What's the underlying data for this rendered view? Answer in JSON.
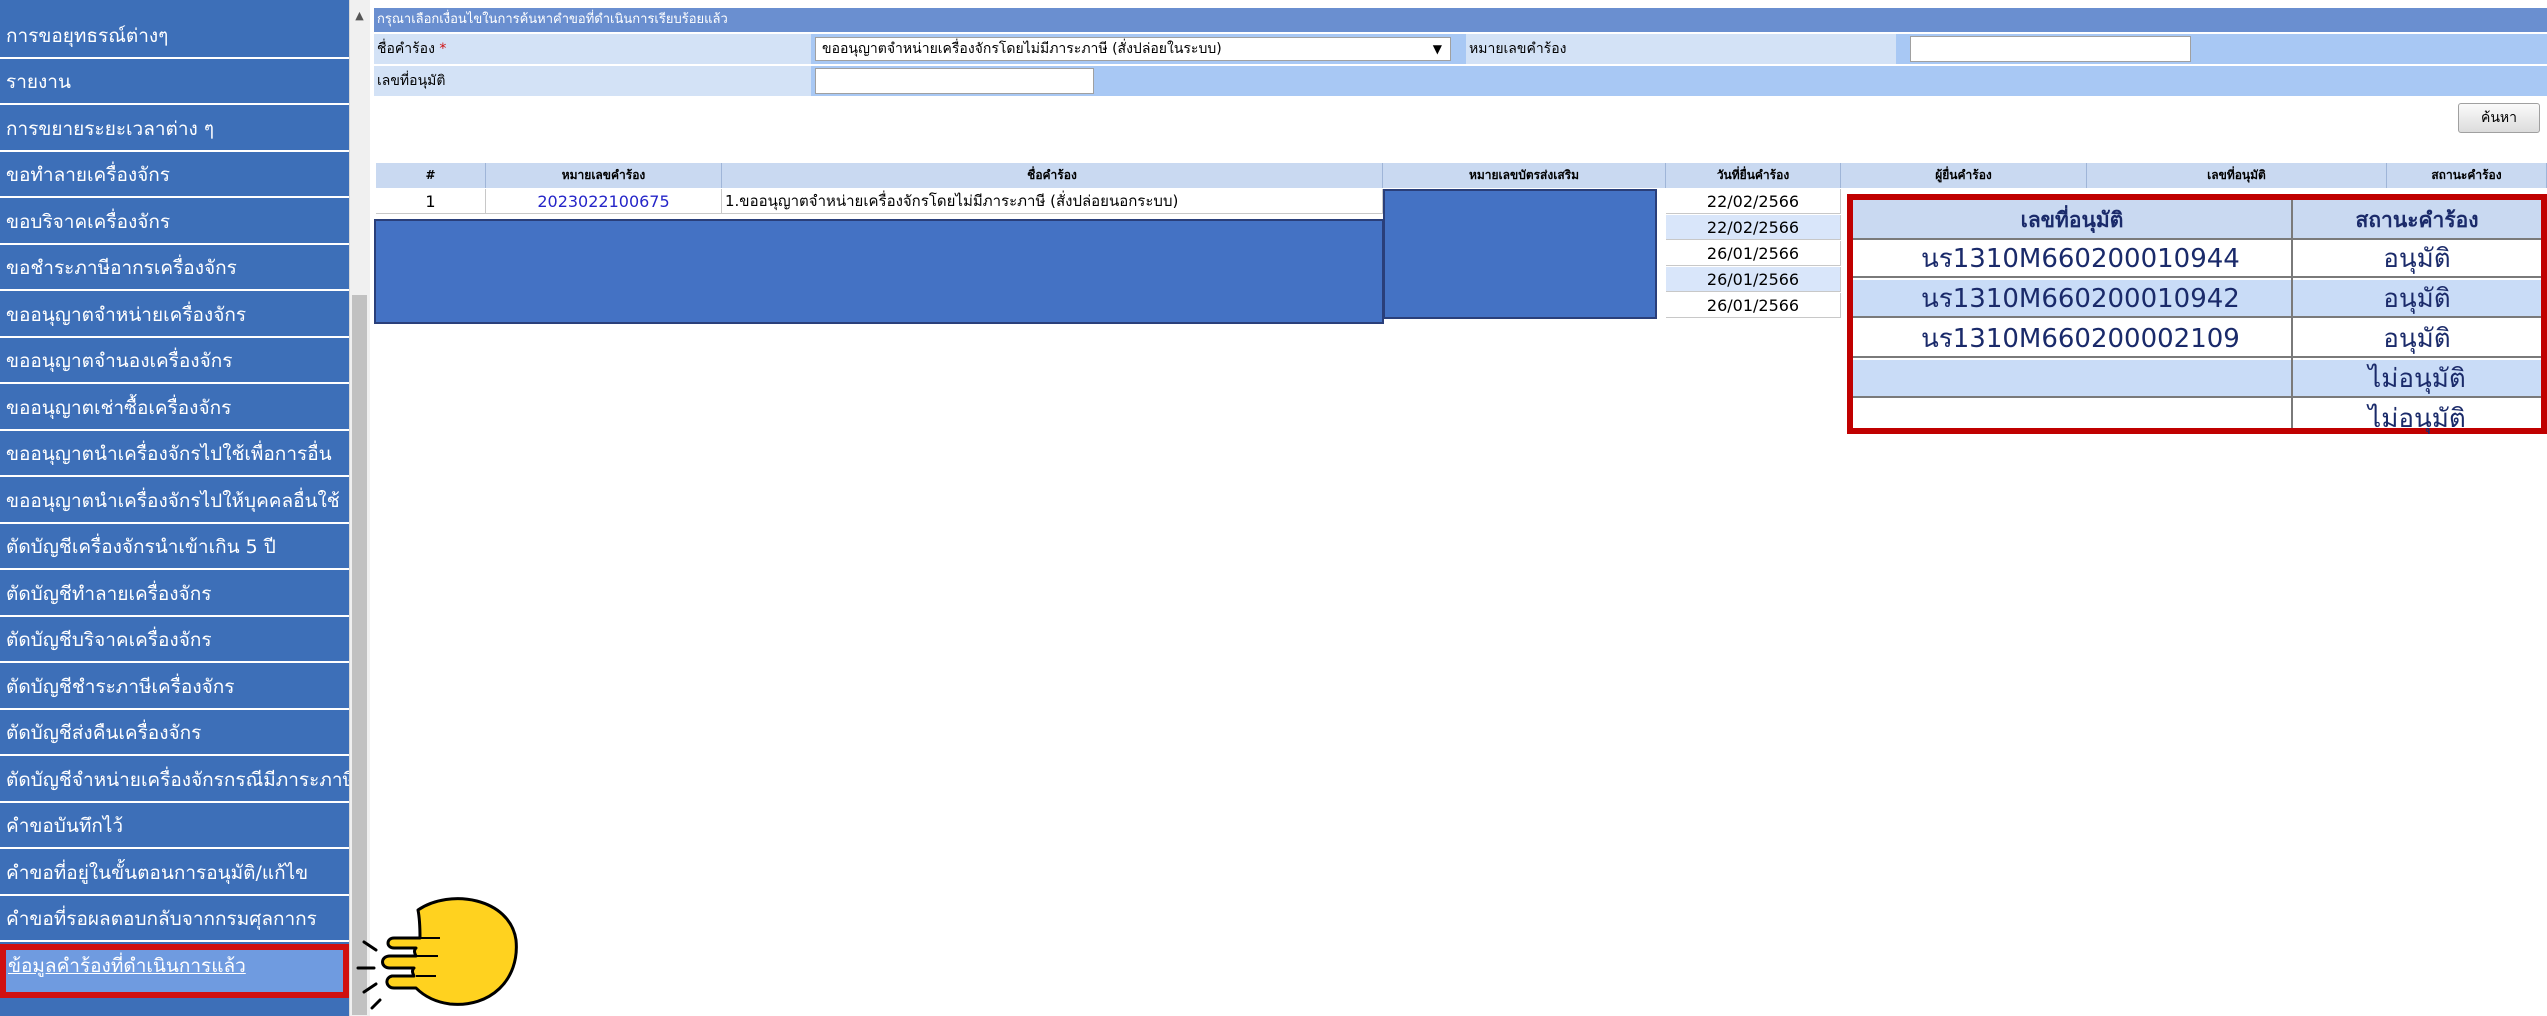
{
  "sidebar": {
    "items": [
      {
        "label": "การขอยุทธรณ์ต่างๆ"
      },
      {
        "label": "รายงาน"
      },
      {
        "label": "การขยายระยะเวลาต่าง ๆ"
      },
      {
        "label": "ขอทำลายเครื่องจักร"
      },
      {
        "label": "ขอบริจาคเครื่องจักร"
      },
      {
        "label": "ขอชำระภาษีอากรเครื่องจักร"
      },
      {
        "label": "ขออนุญาตจำหน่ายเครื่องจักร"
      },
      {
        "label": "ขออนุญาตจำนองเครื่องจักร"
      },
      {
        "label": "ขออนุญาตเช่าซื้อเครื่องจักร"
      },
      {
        "label": "ขออนุญาตนำเครื่องจักรไปใช้เพื่อการอื่น"
      },
      {
        "label": "ขออนุญาตนำเครื่องจักรไปให้บุคคลอื่นใช้"
      },
      {
        "label": "ตัดบัญชีเครื่องจักรนำเข้าเกิน 5 ปี"
      },
      {
        "label": "ตัดบัญชีทำลายเครื่องจักร"
      },
      {
        "label": "ตัดบัญชีบริจาคเครื่องจักร"
      },
      {
        "label": "ตัดบัญชีชำระภาษีเครื่องจักร"
      },
      {
        "label": "ตัดบัญชีส่งคืนเครื่องจักร"
      },
      {
        "label": "ตัดบัญชีจำหน่ายเครื่องจักรกรณีมีภาระภาษี"
      },
      {
        "label": "คำขอบันทึกไว้"
      },
      {
        "label": "คำขอที่อยู่ในขั้นตอนการอนุมัติ/แก้ไข"
      },
      {
        "label": "คำขอที่รอผลตอบกลับจากกรมศุลกากร"
      },
      {
        "label": "ข้อมูลคำร้องที่ดำเนินการแล้ว"
      }
    ]
  },
  "form": {
    "header": "กรุณาเลือกเงื่อนไขในการค้นหาคำขอที่ดำเนินการเรียบร้อยแล้ว",
    "request_name_label": "ชื่อคำร้อง",
    "required_mark": "*",
    "request_name_value": "ขออนุญาตจำหน่ายเครื่องจักรโดยไม่มีภาระภาษี (สั่งปล่อยในระบบ)",
    "request_no_label": "หมายเลขคำร้อง",
    "request_no_value": "",
    "approval_no_label": "เลขที่อนุมัติ",
    "approval_no_value": "",
    "search_button": "ค้นหา"
  },
  "table": {
    "headers": [
      "#",
      "หมายเลขคำร้อง",
      "ชื่อคำร้อง",
      "หมายเลขบัตรส่งเสริม",
      "วันที่ยื่นคำร้อง",
      "ผู้ยื่นคำร้อง",
      "เลขที่อนุมัติ",
      "สถานะคำร้อง"
    ],
    "rows": [
      {
        "no": "1",
        "request_no": "2023022100675",
        "name": "1.ขออนุญาตจำหน่ายเครื่องจักรโดยไม่มีภาระภาษี (สั่งปล่อยนอกระบบ)",
        "date": "22/02/2566"
      },
      {
        "no": "",
        "request_no": "",
        "name": "",
        "date": "22/02/2566"
      },
      {
        "no": "",
        "request_no": "",
        "name": "",
        "date": "26/01/2566"
      },
      {
        "no": "",
        "request_no": "",
        "name": "",
        "date": "26/01/2566"
      },
      {
        "no": "",
        "request_no": "",
        "name": "",
        "date": "26/01/2566"
      }
    ]
  },
  "zoom": {
    "header_approval": "เลขที่อนุมัติ",
    "header_status": "สถานะคำร้อง",
    "rows": [
      {
        "approval": "นร1310M660200010944",
        "status": "อนุมัติ"
      },
      {
        "approval": "นร1310M660200010942",
        "status": "อนุมัติ"
      },
      {
        "approval": "นร1310M660200002109",
        "status": "อนุมัติ"
      },
      {
        "approval": "",
        "status": "ไม่อนุมัติ"
      },
      {
        "approval": "",
        "status": "ไม่อนุมัติ"
      }
    ]
  },
  "icons": {
    "pointer": "pointing-hand-icon"
  },
  "colors": {
    "sidebar": "#3d6fb8",
    "highlight": "#d01010",
    "redaction": "#4472c4"
  }
}
